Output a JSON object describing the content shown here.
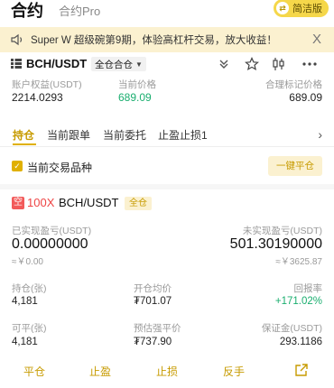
{
  "header": {
    "tab_contract": "合约",
    "tab_pro": "合约Pro",
    "simple_mode": "简洁版"
  },
  "banner": {
    "text": "Super W 超级碗第9期，体验高杠杆交易，放大收益！",
    "close": "X"
  },
  "pair": {
    "name": "BCH/USDT",
    "mode": "全仓合仓"
  },
  "stats": {
    "equity_label": "账户权益(USDT)",
    "equity_value": "2214.0293",
    "price_label": "当前价格",
    "price_value": "689.09",
    "mark_label": "合理标记价格",
    "mark_value": "689.09"
  },
  "tabs": [
    "持仓",
    "当前跟单",
    "当前委托",
    "止盈止损1"
  ],
  "filter": {
    "label": "当前交易品种",
    "close_all": "一键平仓"
  },
  "position": {
    "side": "空",
    "leverage": "100X",
    "pair": "BCH/USDT",
    "margin_mode": "全仓",
    "realized_label": "已实现盈亏(USDT)",
    "realized_value": "0.00000000",
    "realized_cny": "≈￥0.00",
    "unrealized_label": "未实现盈亏(USDT)",
    "unrealized_value": "501.30190000",
    "unrealized_cny": "≈￥3625.87",
    "hold_label": "持仓(张)",
    "hold_value": "4,181",
    "open_avg_label": "开仓均价",
    "open_avg_value": "₮701.07",
    "roe_label": "回报率",
    "roe_value": "+171.02%",
    "closable_label": "可平(张)",
    "closable_value": "4,181",
    "liq_label": "预估强平价",
    "liq_value": "₮737.90",
    "margin_label": "保证金(USDT)",
    "margin_value": "293.1186"
  },
  "actions": {
    "close": "平仓",
    "take_profit": "止盈",
    "stop_loss": "止损",
    "reverse": "反手"
  },
  "colors": {
    "accent": "#e0b000",
    "profit": "#1aae6f",
    "short": "#f25a5a"
  }
}
